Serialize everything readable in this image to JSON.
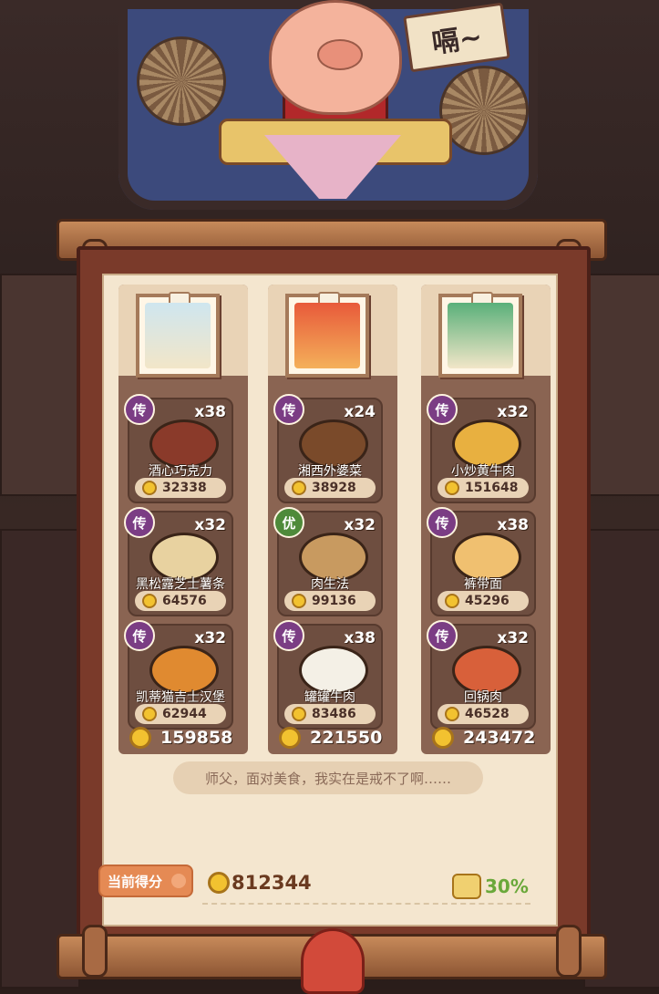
{
  "header": {
    "sign_text": "嗝~"
  },
  "columns": [
    {
      "portrait_icon": "avatar-white-haired-girl",
      "dishes": [
        {
          "rarity": "传",
          "rarity_type": "legend",
          "count": "x38",
          "name": "酒心巧克力",
          "score": "32338",
          "dish_color": "#8a3a2a"
        },
        {
          "rarity": "传",
          "rarity_type": "legend",
          "count": "x32",
          "name": "黑松露芝士薯条",
          "score": "64576",
          "dish_color": "#e8d2a0"
        },
        {
          "rarity": "传",
          "rarity_type": "legend",
          "count": "x32",
          "name": "凯蒂猫吉士汉堡",
          "score": "62944",
          "dish_color": "#e08a30"
        }
      ],
      "total": "159858"
    },
    {
      "portrait_icon": "avatar-red-haired-girl",
      "dishes": [
        {
          "rarity": "传",
          "rarity_type": "legend",
          "count": "x24",
          "name": "湘西外婆菜",
          "score": "38928",
          "dish_color": "#7a4a2a"
        },
        {
          "rarity": "优",
          "rarity_type": "excellent",
          "count": "x32",
          "name": "肉生法",
          "score": "99136",
          "dish_color": "#c89a60"
        },
        {
          "rarity": "传",
          "rarity_type": "legend",
          "count": "x38",
          "name": "罐罐牛肉",
          "score": "83486",
          "dish_color": "#f4f0e6"
        }
      ],
      "total": "221550"
    },
    {
      "portrait_icon": "avatar-green-haired-boy",
      "dishes": [
        {
          "rarity": "传",
          "rarity_type": "legend",
          "count": "x32",
          "name": "小炒黄牛肉",
          "score": "151648",
          "dish_color": "#e8b040"
        },
        {
          "rarity": "传",
          "rarity_type": "legend",
          "count": "x38",
          "name": "裤带面",
          "score": "45296",
          "dish_color": "#f0c070"
        },
        {
          "rarity": "传",
          "rarity_type": "legend",
          "count": "x32",
          "name": "回锅肉",
          "score": "46528",
          "dish_color": "#d8603a"
        }
      ],
      "total": "243472"
    }
  ],
  "quote": "师父，面对美食，我实在是戒不了啊……",
  "footer": {
    "score_label": "当前得分",
    "total_score": "812344",
    "percent": "30%"
  },
  "colors": {
    "legend": "#7b3d84",
    "excellent": "#4e8a3a",
    "paper": "#f4e6cf",
    "coin": "#f2c230",
    "percent": "#6aa83a"
  }
}
